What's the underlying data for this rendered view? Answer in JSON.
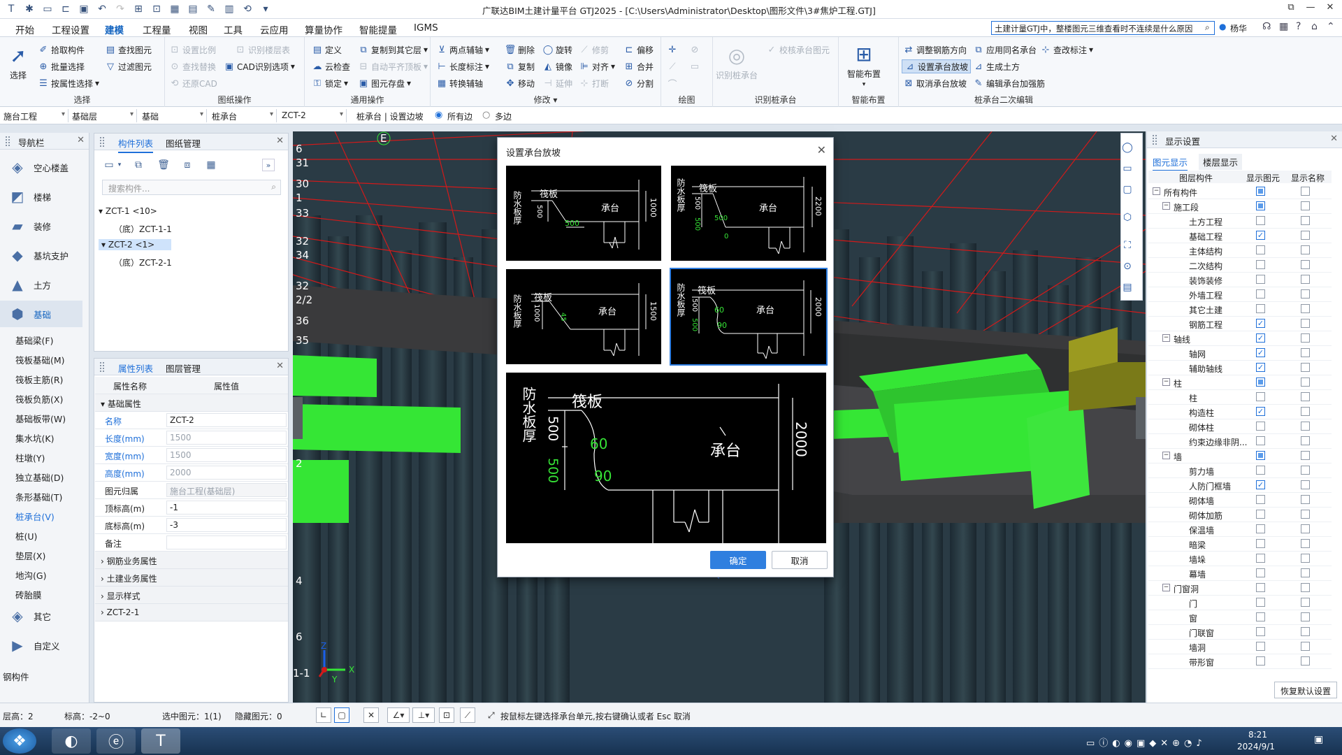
{
  "window": {
    "title": "广联达BIM土建计量平台 GTJ2025 - [C:\\Users\\Administrator\\Desktop\\图形文件\\3#焦炉工程.GTJ]",
    "user": "杨华"
  },
  "menu": {
    "items": [
      "开始",
      "工程设置",
      "建模",
      "工程量",
      "视图",
      "工具",
      "云应用",
      "算量协作",
      "智能提量",
      "IGMS"
    ],
    "active": "建模",
    "search_text": "土建计量GTJ中，整楼图元三维查看时不连续是什么原因"
  },
  "ribbon": {
    "select": {
      "label": "选择",
      "big": "选择",
      "pick": "拾取构件",
      "batch": "批量选择",
      "by_attr": "按属性选择",
      "find": "查找图元",
      "filter": "过滤图元"
    },
    "drawing": {
      "label": "图纸操作",
      "scale": "设置比例",
      "recog_layer": "识别楼层表",
      "find_replace": "查找替换",
      "cad_opt": "CAD识别选项",
      "restore": "还原CAD"
    },
    "general": {
      "label": "通用操作",
      "define": "定义",
      "copy_to": "复制到其它层",
      "cloud_check": "云检查",
      "auto_level": "自动平齐顶板",
      "lock": "锁定",
      "save_elem": "图元存盘"
    },
    "modify": {
      "label": "修改",
      "two_point": "两点辅轴",
      "length_mark": "长度标注",
      "convert_axis": "转换辅轴",
      "delete": "删除",
      "rotate": "旋转",
      "trim": "修剪",
      "offset": "偏移",
      "copy": "复制",
      "mirror": "镜像",
      "align": "对齐",
      "merge": "合并",
      "move": "移动",
      "extend": "延伸",
      "break": "打断",
      "split": "分割"
    },
    "draw": {
      "label": "绘图"
    },
    "recognize": {
      "label": "识别桩承台",
      "recog": "识别桩承台",
      "verify": "校核承台图元"
    },
    "smart": {
      "label": "智能布置",
      "big": "智能布置"
    },
    "cap_edit": {
      "label": "桩承台二次编辑",
      "adjust_rebar": "调整钢筋方向",
      "apply_same": "应用同名承台",
      "view_mark": "查改标注",
      "set_slope": "设置承台放坡",
      "gen_earth": "生成土方",
      "cancel_slope": "取消承台放坡",
      "edit_rebar": "编辑承台加强筋"
    }
  },
  "selectors": {
    "project": "施台工程",
    "layer": "基础层",
    "category": "基础",
    "type": "桩承台",
    "element": "ZCT-2",
    "mode_label": "桩承台 | 设置边坡",
    "radio_all": "所有边",
    "radio_multi": "多边"
  },
  "nav": {
    "title": "导航栏",
    "big_items": [
      "空心楼盖",
      "楼梯",
      "装修",
      "基坑支护",
      "土方",
      "基础"
    ],
    "active_big": "基础",
    "sub_items": [
      "基础梁(F)",
      "筏板基础(M)",
      "筏板主筋(R)",
      "筏板负筋(X)",
      "基础板带(W)",
      "集水坑(K)",
      "柱墩(Y)",
      "独立基础(D)",
      "条形基础(T)",
      "桩承台(V)",
      "桩(U)",
      "垫层(X)",
      "地沟(G)",
      "砖胎膜"
    ],
    "active_sub": "桩承台(V)",
    "other": "其它",
    "custom": "自定义",
    "steel": "钢构件"
  },
  "components": {
    "tab_list": "构件列表",
    "tab_drawing": "图纸管理",
    "search_placeholder": "搜索构件...",
    "tree": [
      "ZCT-1 <10>",
      "（底）ZCT-1-1",
      "ZCT-2 <1>",
      "（底）ZCT-2-1"
    ]
  },
  "properties": {
    "tab_props": "属性列表",
    "tab_layers": "图层管理",
    "col_name": "属性名称",
    "col_value": "属性值",
    "section_basic": "基础属性",
    "rows": [
      {
        "name": "名称",
        "value": "ZCT-2"
      },
      {
        "name": "长度(mm)",
        "value": "1500"
      },
      {
        "name": "宽度(mm)",
        "value": "1500"
      },
      {
        "name": "高度(mm)",
        "value": "2000"
      },
      {
        "name": "图元归属",
        "value": "施台工程(基础层)"
      },
      {
        "name": "顶标高(m)",
        "value": "-1"
      },
      {
        "name": "底标高(m)",
        "value": "-3"
      },
      {
        "name": "备注",
        "value": ""
      }
    ],
    "sections": [
      "钢筋业务属性",
      "土建业务属性",
      "显示样式",
      "ZCT-2-1"
    ]
  },
  "viewport": {
    "axis_labels": [
      "E",
      "6",
      "31",
      "30",
      "1",
      "33",
      "32",
      "34",
      "32",
      "2/2",
      "36",
      "35",
      "2",
      "4",
      "6",
      "1-1"
    ],
    "axis_x": "X",
    "axis_y": "Y",
    "axis_z": "Z"
  },
  "dialog": {
    "title": "设置承台放坡",
    "label_waterproof": "防水板厚",
    "label_raft": "筏板",
    "label_cap": "承台",
    "options": [
      {
        "d1": "500",
        "d2": "500",
        "height": "1000"
      },
      {
        "d1": "500",
        "d2": "500",
        "d3": "0",
        "height": "2200"
      },
      {
        "d1": "1000",
        "d2": "45",
        "height": "1500"
      },
      {
        "d1": "500",
        "d2": "500",
        "a1": "60",
        "a2": "90",
        "height": "2000"
      }
    ],
    "selected_index": 3,
    "preview": {
      "d1": "500",
      "d2": "500",
      "a1": "60",
      "a2": "90",
      "height": "2000"
    },
    "ok": "确定",
    "cancel": "取消"
  },
  "display_panel": {
    "title": "显示设置",
    "tab_elements": "图元显示",
    "tab_floors": "楼层显示",
    "col_component": "图层构件",
    "col_show": "显示图元",
    "col_name": "显示名称",
    "rows": [
      {
        "label": "所有构件",
        "level": 0,
        "expand": true,
        "show": "partial",
        "name": false
      },
      {
        "label": "施工段",
        "level": 1,
        "expand": true,
        "show": "partial",
        "name": false
      },
      {
        "label": "土方工程",
        "level": 2,
        "show": false,
        "name": false
      },
      {
        "label": "基础工程",
        "level": 2,
        "show": true,
        "name": false
      },
      {
        "label": "主体结构",
        "level": 2,
        "show": false,
        "name": false
      },
      {
        "label": "二次结构",
        "level": 2,
        "show": false,
        "name": false
      },
      {
        "label": "装饰装修",
        "level": 2,
        "show": false,
        "name": false
      },
      {
        "label": "外墙工程",
        "level": 2,
        "show": false,
        "name": false
      },
      {
        "label": "其它土建",
        "level": 2,
        "show": false,
        "name": false
      },
      {
        "label": "钢筋工程",
        "level": 2,
        "show": true,
        "name": false
      },
      {
        "label": "轴线",
        "level": 1,
        "expand": true,
        "show": true,
        "name": false
      },
      {
        "label": "轴网",
        "level": 2,
        "show": true,
        "name": false
      },
      {
        "label": "辅助轴线",
        "level": 2,
        "show": true,
        "name": false
      },
      {
        "label": "柱",
        "level": 1,
        "expand": true,
        "show": "partial",
        "name": false
      },
      {
        "label": "柱",
        "level": 2,
        "show": false,
        "name": false
      },
      {
        "label": "构造柱",
        "level": 2,
        "show": true,
        "name": false
      },
      {
        "label": "砌体柱",
        "level": 2,
        "show": false,
        "name": false
      },
      {
        "label": "约束边缘非阴...",
        "level": 2,
        "show": false,
        "name": false
      },
      {
        "label": "墙",
        "level": 1,
        "expand": true,
        "show": "partial",
        "name": false
      },
      {
        "label": "剪力墙",
        "level": 2,
        "show": false,
        "name": false
      },
      {
        "label": "人防门框墙",
        "level": 2,
        "show": true,
        "name": false
      },
      {
        "label": "砌体墙",
        "level": 2,
        "show": false,
        "name": false
      },
      {
        "label": "砌体加筋",
        "level": 2,
        "show": false,
        "name": false
      },
      {
        "label": "保温墙",
        "level": 2,
        "show": false,
        "name": false
      },
      {
        "label": "暗梁",
        "level": 2,
        "show": false,
        "name": false
      },
      {
        "label": "墙垛",
        "level": 2,
        "show": false,
        "name": false
      },
      {
        "label": "幕墙",
        "level": 2,
        "show": false,
        "name": false
      },
      {
        "label": "门窗洞",
        "level": 1,
        "expand": true,
        "show": false,
        "name": false
      },
      {
        "label": "门",
        "level": 2,
        "show": false,
        "name": false
      },
      {
        "label": "窗",
        "level": 2,
        "show": false,
        "name": false
      },
      {
        "label": "门联窗",
        "level": 2,
        "show": false,
        "name": false
      },
      {
        "label": "墙洞",
        "level": 2,
        "show": false,
        "name": false
      },
      {
        "label": "带形窗",
        "level": 2,
        "show": false,
        "name": false
      }
    ],
    "restore": "恢复默认设置"
  },
  "status": {
    "floor": "层高：2",
    "elev": "标高：-2~0",
    "selected": "选中图元：1(1)",
    "hidden": "隐藏图元：0",
    "hint": "按鼠标左键选择承台单元,按右键确认或者 Esc 取消"
  },
  "taskbar": {
    "time": "8:21",
    "date": "2024/9/1"
  },
  "colors": {
    "accent": "#1e6fd9",
    "green_elem": "#35e635",
    "blue_elem": "#1a5fe8",
    "red_grid": "#d01818"
  }
}
